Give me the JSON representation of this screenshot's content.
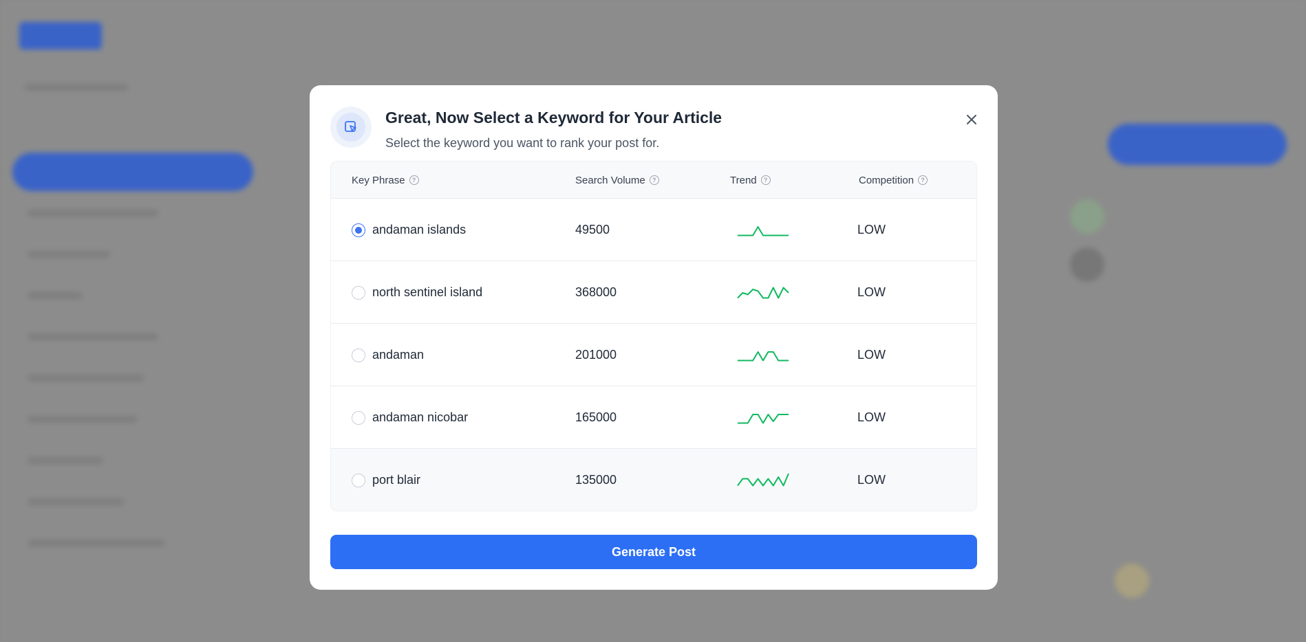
{
  "modal": {
    "title": "Great, Now Select a Keyword for Your Article",
    "subtitle": "Select the keyword you want to rank your post for.",
    "header_icon": "cursor-select-icon",
    "close_icon": "close-icon"
  },
  "table": {
    "headers": {
      "key_phrase": "Key Phrase",
      "search_volume": "Search Volume",
      "trend": "Trend",
      "competition": "Competition"
    },
    "help_icon": "question-circle-icon",
    "trend_color": "#10b95f",
    "rows": [
      {
        "keyword": "andaman islands",
        "volume": "49500",
        "competition": "LOW",
        "selected": true,
        "trend": [
          2,
          2,
          2,
          2,
          12,
          2,
          2,
          2,
          2,
          2,
          2
        ]
      },
      {
        "keyword": "north sentinel island",
        "volume": "368000",
        "competition": "LOW",
        "selected": false,
        "trend": [
          2,
          8,
          6,
          12,
          10,
          2,
          2,
          14,
          2,
          14,
          8
        ]
      },
      {
        "keyword": "andaman",
        "volume": "201000",
        "competition": "LOW",
        "selected": false,
        "trend": [
          2,
          2,
          2,
          2,
          12,
          2,
          12,
          12,
          2,
          2,
          2
        ]
      },
      {
        "keyword": "andaman nicobar",
        "volume": "165000",
        "competition": "LOW",
        "selected": false,
        "trend": [
          2,
          2,
          2,
          12,
          12,
          2,
          12,
          4,
          12,
          12,
          12
        ]
      },
      {
        "keyword": "port blair",
        "volume": "135000",
        "competition": "LOW",
        "selected": false,
        "trend": [
          2,
          10,
          10,
          2,
          10,
          2,
          10,
          2,
          12,
          2,
          16
        ]
      }
    ]
  },
  "actions": {
    "generate_label": "Generate Post",
    "accent": "#2c6ff5"
  }
}
